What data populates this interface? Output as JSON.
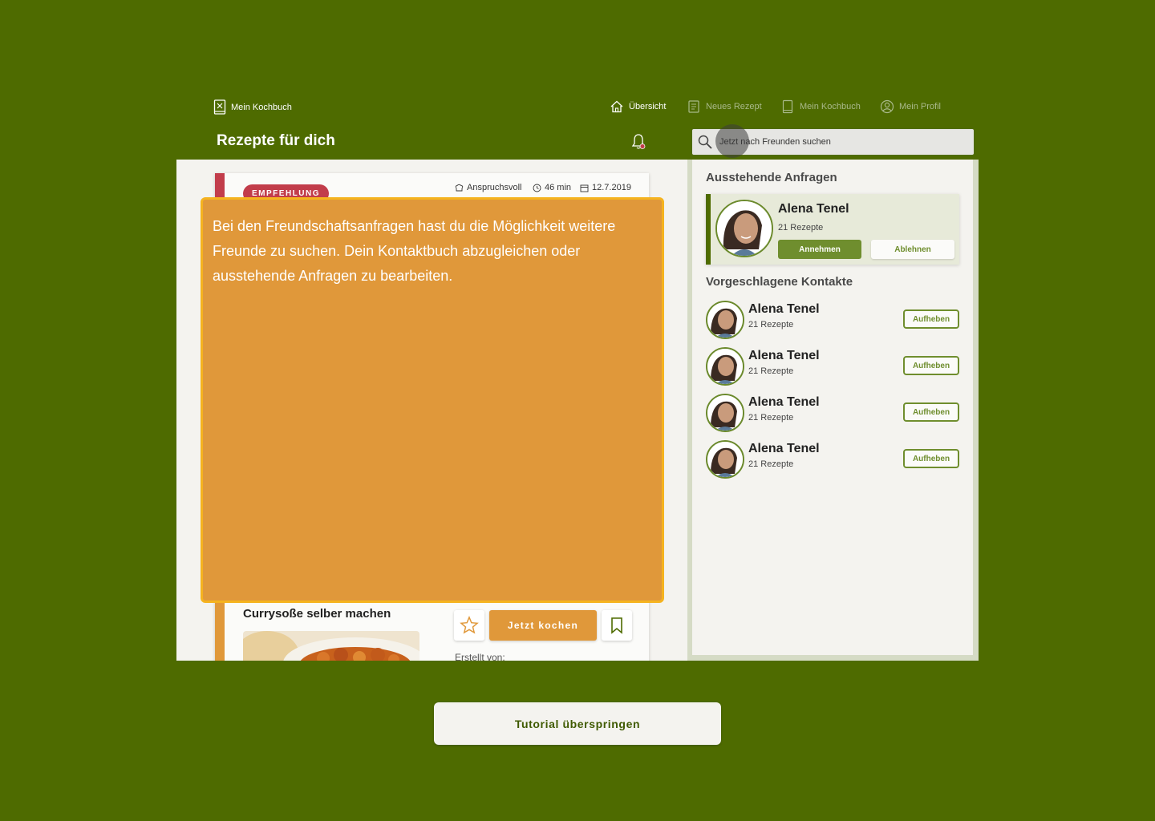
{
  "brand": {
    "label": "Mein Kochbuch",
    "icon": "cookbook-icon"
  },
  "nav": {
    "items": [
      {
        "label": "Übersicht",
        "icon": "home-icon",
        "active": true
      },
      {
        "label": "Neues Rezept",
        "icon": "new-recipe-icon",
        "active": false
      },
      {
        "label": "Mein Kochbuch",
        "icon": "cookbook-icon",
        "active": false
      },
      {
        "label": "Mein Profil",
        "icon": "profile-icon",
        "active": false
      }
    ]
  },
  "header": {
    "title": "Rezepte für dich"
  },
  "search": {
    "placeholder": "Jetzt nach Freunden suchen"
  },
  "recipe_card": {
    "badge": "EMPFEHLUNG",
    "difficulty": "Anspruchsvoll",
    "duration": "46 min",
    "date": "12.7.2019",
    "title": "Currysoße selber machen",
    "cook_label": "Jetzt kochen",
    "created_by": "Erstellt von:"
  },
  "tooltip": {
    "text": "Bei den Freundschaftsanfragen hast du die Möglichkeit weitere Freunde zu suchen. Dein Kontaktbuch abzugleichen oder ausstehende Anfragen zu bearbeiten."
  },
  "pending": {
    "title": "Ausstehende Anfragen",
    "request": {
      "name": "Alena Tenel",
      "recipes": "21 Rezepte",
      "accept_label": "Annehmen",
      "decline_label": "Ablehnen"
    }
  },
  "suggested": {
    "title": "Vorgeschlagene Kontakte",
    "contacts": [
      {
        "name": "Alena Tenel",
        "recipes": "21 Rezepte",
        "action": "Aufheben"
      },
      {
        "name": "Alena Tenel",
        "recipes": "21 Rezepte",
        "action": "Aufheben"
      },
      {
        "name": "Alena Tenel",
        "recipes": "21 Rezepte",
        "action": "Aufheben"
      },
      {
        "name": "Alena Tenel",
        "recipes": "21 Rezepte",
        "action": "Aufheben"
      }
    ]
  },
  "skip": {
    "label": "Tutorial überspringen"
  },
  "colors": {
    "background": "#4e6b00",
    "accent_orange": "#e0983a",
    "accent_red": "#c23d4b",
    "accent_green": "#6f8e2e",
    "tooltip_border": "#f5b31f"
  }
}
